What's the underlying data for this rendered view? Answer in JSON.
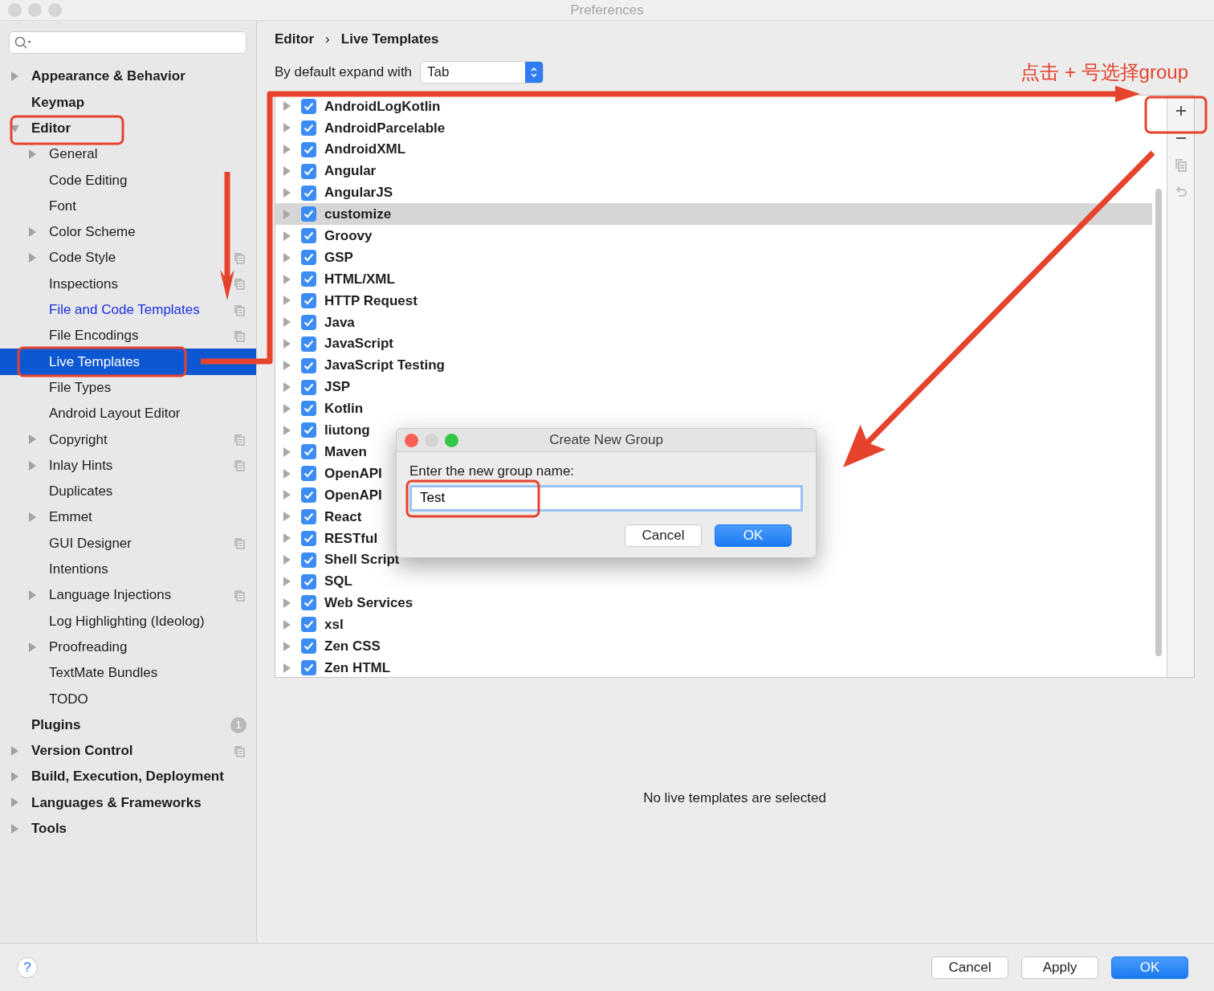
{
  "window": {
    "title": "Preferences"
  },
  "sidebar": {
    "items": [
      {
        "label": "Appearance & Behavior",
        "expanded": false,
        "selected": false
      },
      {
        "label": "Keymap",
        "selected": false
      },
      {
        "label": "Editor",
        "expanded": true,
        "selected": false,
        "children": [
          {
            "label": "General",
            "expanded": false,
            "selected": false
          },
          {
            "label": "Code Editing",
            "selected": false
          },
          {
            "label": "Font",
            "selected": false
          },
          {
            "label": "Color Scheme",
            "expanded": false,
            "selected": false
          },
          {
            "label": "Code Style",
            "expanded": false,
            "selected": false,
            "project_level": true
          },
          {
            "label": "Inspections",
            "selected": false,
            "project_level": true
          },
          {
            "label": "File and Code Templates",
            "selected": false,
            "modified": true,
            "project_level": true
          },
          {
            "label": "File Encodings",
            "selected": false,
            "project_level": true
          },
          {
            "label": "Live Templates",
            "selected": true
          },
          {
            "label": "File Types",
            "selected": false
          },
          {
            "label": "Android Layout Editor",
            "selected": false
          },
          {
            "label": "Copyright",
            "expanded": false,
            "selected": false,
            "project_level": true
          },
          {
            "label": "Inlay Hints",
            "expanded": false,
            "selected": false,
            "project_level": true
          },
          {
            "label": "Duplicates",
            "selected": false
          },
          {
            "label": "Emmet",
            "expanded": false,
            "selected": false
          },
          {
            "label": "GUI Designer",
            "selected": false,
            "project_level": true
          },
          {
            "label": "Intentions",
            "selected": false
          },
          {
            "label": "Language Injections",
            "expanded": false,
            "selected": false,
            "project_level": true
          },
          {
            "label": "Log Highlighting (Ideolog)",
            "selected": false
          },
          {
            "label": "Proofreading",
            "expanded": false,
            "selected": false
          },
          {
            "label": "TextMate Bundles",
            "selected": false
          },
          {
            "label": "TODO",
            "selected": false
          }
        ]
      },
      {
        "label": "Plugins",
        "selected": false,
        "badge": "1"
      },
      {
        "label": "Version Control",
        "expanded": false,
        "selected": false,
        "project_level": true
      },
      {
        "label": "Build, Execution, Deployment",
        "expanded": false,
        "selected": false
      },
      {
        "label": "Languages & Frameworks",
        "expanded": false,
        "selected": false
      },
      {
        "label": "Tools",
        "expanded": false,
        "selected": false
      }
    ]
  },
  "breadcrumb": [
    "Editor",
    "Live Templates"
  ],
  "breadcrumb_separator": "›",
  "expand_with": {
    "label": "By default expand with",
    "value": "Tab"
  },
  "annotation": {
    "text": "点击 + 号选择group"
  },
  "templates": [
    {
      "label": "AndroidLogKotlin",
      "checked": true,
      "selected": false
    },
    {
      "label": "AndroidParcelable",
      "checked": true,
      "selected": false
    },
    {
      "label": "AndroidXML",
      "checked": true,
      "selected": false
    },
    {
      "label": "Angular",
      "checked": true,
      "selected": false
    },
    {
      "label": "AngularJS",
      "checked": true,
      "selected": false
    },
    {
      "label": "customize",
      "checked": true,
      "selected": true
    },
    {
      "label": "Groovy",
      "checked": true,
      "selected": false
    },
    {
      "label": "GSP",
      "checked": true,
      "selected": false
    },
    {
      "label": "HTML/XML",
      "checked": true,
      "selected": false
    },
    {
      "label": "HTTP Request",
      "checked": true,
      "selected": false
    },
    {
      "label": "Java",
      "checked": true,
      "selected": false
    },
    {
      "label": "JavaScript",
      "checked": true,
      "selected": false
    },
    {
      "label": "JavaScript Testing",
      "checked": true,
      "selected": false
    },
    {
      "label": "JSP",
      "checked": true,
      "selected": false
    },
    {
      "label": "Kotlin",
      "checked": true,
      "selected": false
    },
    {
      "label": "liutong",
      "checked": true,
      "selected": false
    },
    {
      "label": "Maven",
      "checked": true,
      "selected": false
    },
    {
      "label": "OpenAPI",
      "checked": true,
      "selected": false
    },
    {
      "label": "OpenAPI",
      "checked": true,
      "selected": false
    },
    {
      "label": "React",
      "checked": true,
      "selected": false
    },
    {
      "label": "RESTful",
      "checked": true,
      "selected": false
    },
    {
      "label": "Shell Script",
      "checked": true,
      "selected": false
    },
    {
      "label": "SQL",
      "checked": true,
      "selected": false
    },
    {
      "label": "Web Services",
      "checked": true,
      "selected": false
    },
    {
      "label": "xsl",
      "checked": true,
      "selected": false
    },
    {
      "label": "Zen CSS",
      "checked": true,
      "selected": false
    },
    {
      "label": "Zen HTML",
      "checked": true,
      "selected": false
    }
  ],
  "toolbar": [
    {
      "kind": "add",
      "disabled": false
    },
    {
      "kind": "remove",
      "disabled": false
    },
    {
      "kind": "copy",
      "disabled": true
    },
    {
      "kind": "revert",
      "disabled": true
    }
  ],
  "empty_message": "No live templates are selected",
  "dialog": {
    "title": "Create New Group",
    "prompt": "Enter the new group name:",
    "value": "Test",
    "buttons": [
      {
        "label": "Cancel",
        "default": false
      },
      {
        "label": "OK",
        "default": true
      }
    ]
  },
  "help": "?",
  "footer_buttons": [
    {
      "label": "Cancel",
      "default": false
    },
    {
      "label": "Apply",
      "default": false
    },
    {
      "label": "OK",
      "default": true
    }
  ]
}
